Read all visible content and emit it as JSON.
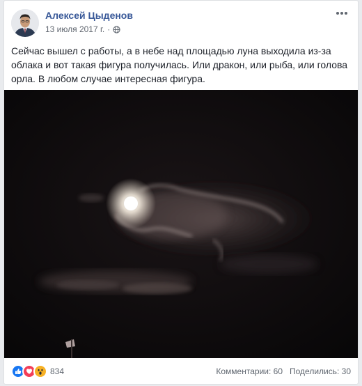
{
  "post": {
    "author": "Алексей Цыденов",
    "date": "13 июля 2017 г.",
    "separator": "·",
    "privacy_icon": "globe-icon",
    "more_icon": "more-options-icon",
    "text": "Сейчас вышел с работы, а в небе над площадью луна выходила из-за облака и вот такая фигура получилась. Или дракон, или рыба, или голова орла. В любом случае интересная фигура."
  },
  "photo": {
    "subject": "moon-behind-cloud-at-night"
  },
  "footer": {
    "reaction_icons": [
      "like-icon",
      "love-icon",
      "wow-icon"
    ],
    "reaction_count": "834",
    "comments": "Комментарии: 60",
    "shares": "Поделились: 30"
  },
  "colors": {
    "author_link": "#385898",
    "like": "#1877f2",
    "love": "#f33e58",
    "wow": "#f7b125"
  }
}
